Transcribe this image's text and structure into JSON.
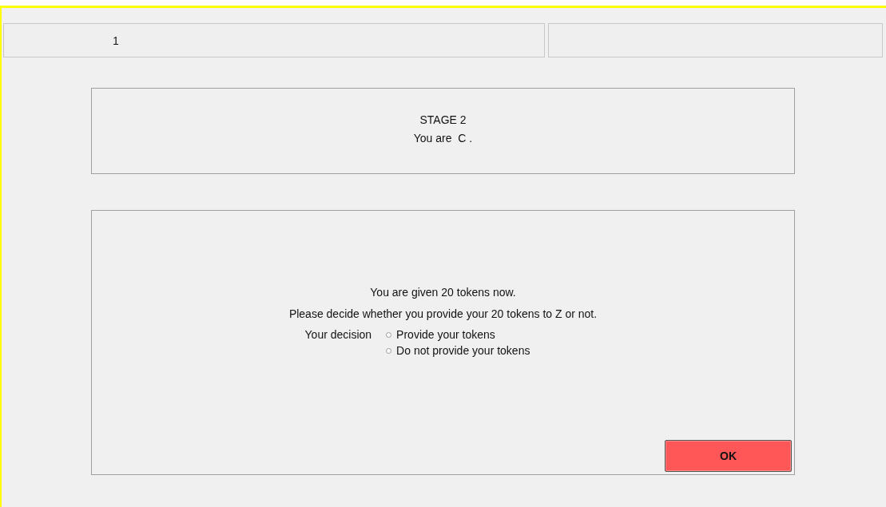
{
  "header": {
    "period": "1"
  },
  "stage": {
    "title": "STAGE 2",
    "role_line": "You are  C ."
  },
  "decision": {
    "lines": [
      "You are given 20 tokens now.",
      "Please decide whether you provide your 20 tokens to Z or not."
    ],
    "label": "Your decision",
    "options": [
      {
        "label": "Provide your tokens",
        "selected": false
      },
      {
        "label": "Do not provide your tokens",
        "selected": false
      }
    ],
    "button": "OK"
  }
}
